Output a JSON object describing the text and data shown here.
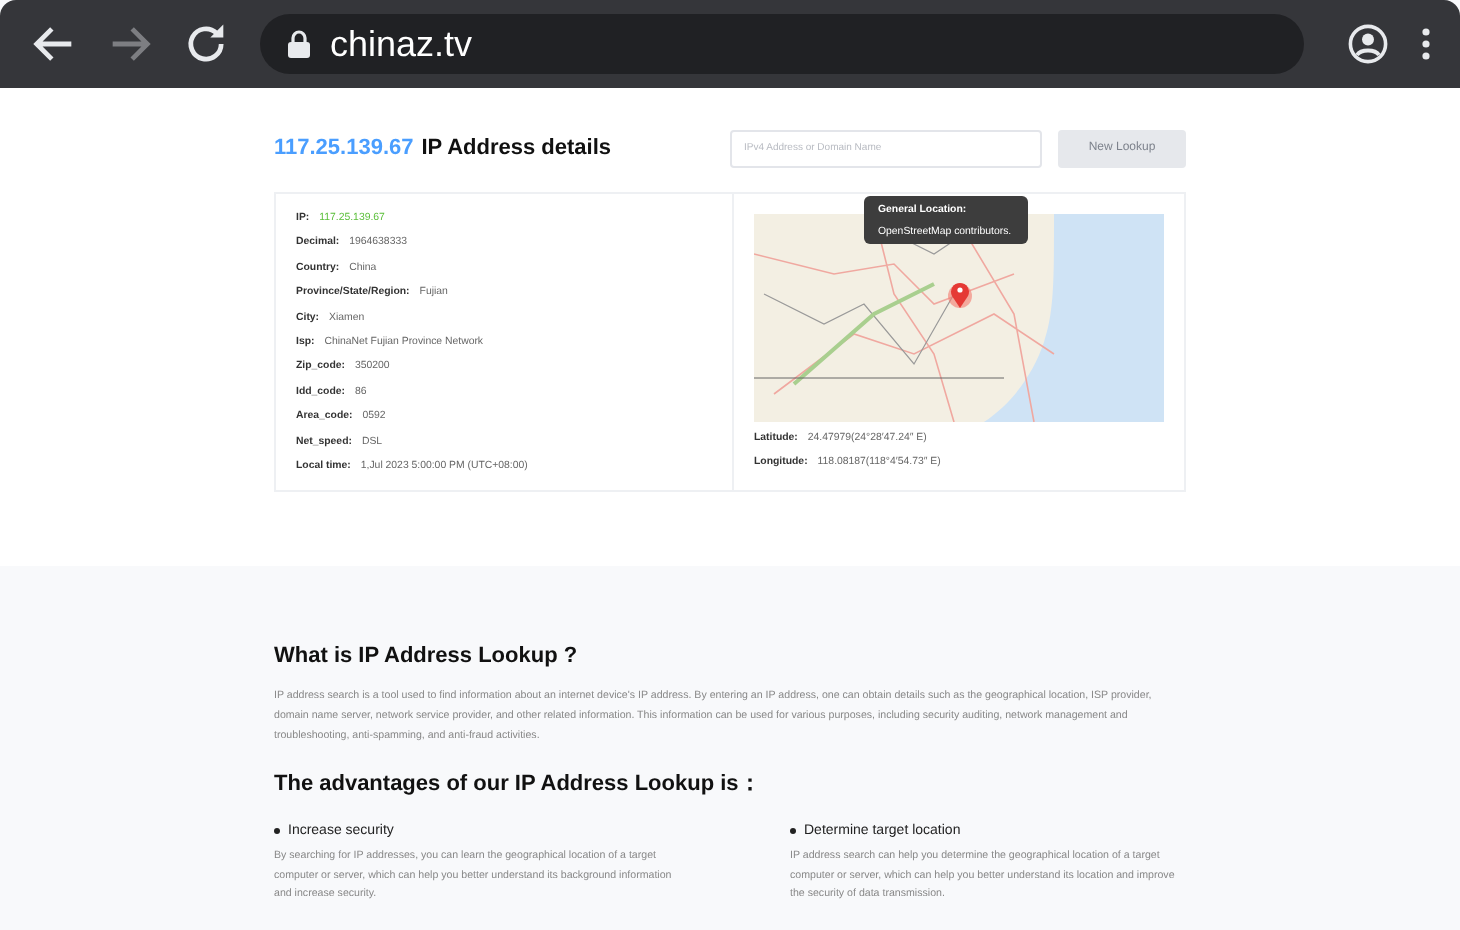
{
  "browser": {
    "url": "chinaz.tv",
    "back_disabled": false,
    "forward_disabled": true
  },
  "header": {
    "ip": "117.25.139.67",
    "title": "IP Address details",
    "search_placeholder": "IPv4 Address or Domain Name",
    "button": {
      "label": "New Lookup",
      "disabled": true
    }
  },
  "details": [
    {
      "label": "IP:",
      "value": "117.25.139.67",
      "kind": "highlight"
    },
    {
      "label": "Decimal:",
      "value": "1964638333",
      "kind": "plain"
    },
    {
      "label": "Country:",
      "value": "China",
      "kind": "plain"
    },
    {
      "label": "Province/State/Region:",
      "value": "Fujian",
      "kind": "plain"
    },
    {
      "label": "City:",
      "value": "Xiamen",
      "kind": "plain"
    },
    {
      "label": "Isp:",
      "value": "ChinaNet Fujian Province Network",
      "kind": "plain"
    },
    {
      "label": "Zip_code:",
      "value": "350200",
      "kind": "plain"
    },
    {
      "label": "Idd_code:",
      "value": "86",
      "kind": "plain"
    },
    {
      "label": "Area_code:",
      "value": "0592",
      "kind": "plain"
    },
    {
      "label": "Net_speed:",
      "value": "DSL",
      "kind": "plain"
    },
    {
      "label": "Local time:",
      "value": "1,Jul 2023 5:00:00 PM (UTC+08:00)",
      "kind": "plain"
    }
  ],
  "map": {
    "tooltip_title": "General Location:",
    "tooltip_text": "OpenStreetMap contributors.",
    "coordinates": [
      {
        "label": "Latitude:",
        "value": "24.47979(24°28′47.24″ E)"
      },
      {
        "label": "Longitude:",
        "value": "118.08187(118°4′54.73″ E)"
      }
    ]
  },
  "about": {
    "heading": "What is IP Address Lookup ?",
    "paragraph": "IP address search is a tool used to find information about an internet device's IP address. By entering an IP address, one can obtain details such as the geographical location, ISP provider, domain name server, network service provider, and other related information. This information can be used for various purposes, including security auditing, network management and troubleshooting, anti-spamming, and anti-fraud activities."
  },
  "advantages": {
    "heading": "The advantages of our IP Address Lookup is：",
    "items": [
      {
        "title": "Increase security",
        "text": "By searching for IP addresses, you can learn the geographical location of a target computer or server, which can help you better understand its background information and increase security."
      },
      {
        "title": "Determine target location",
        "text": "IP address search can help you determine the geographical location of a target computer or server, which can help you better understand its location and improve the security of data transmission."
      }
    ]
  }
}
